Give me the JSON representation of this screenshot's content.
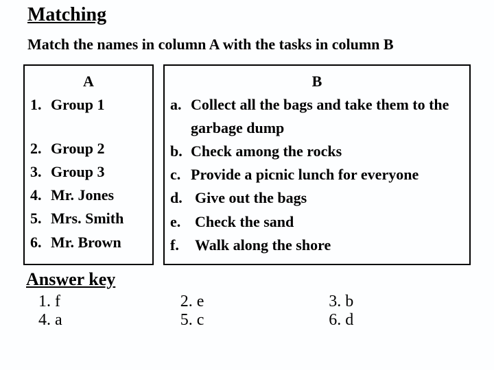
{
  "heading": "Matching",
  "instruction": "Match the names in column A with the tasks in column B",
  "colA": {
    "header": "A",
    "items": [
      {
        "num": "1.",
        "text": "Group 1"
      },
      {
        "num": "2.",
        "text": "Group 2"
      },
      {
        "num": "3.",
        "text": "Group 3"
      },
      {
        "num": "4.",
        "text": "Mr. Jones"
      },
      {
        "num": "5.",
        "text": "Mrs. Smith"
      },
      {
        "num": "6.",
        "text": "Mr. Brown"
      }
    ]
  },
  "colB": {
    "header": "B",
    "items": [
      {
        "num": "a.",
        "text": "Collect all the bags and take them to the garbage dump"
      },
      {
        "num": "b.",
        "text": "Check among the rocks"
      },
      {
        "num": "c.",
        "text": "Provide a picnic lunch for everyone"
      },
      {
        "num": "d.",
        "text": "Give out the bags"
      },
      {
        "num": "e.",
        "text": "Check the sand"
      },
      {
        "num": "f.",
        "text": "Walk along the shore"
      }
    ]
  },
  "answer_key_title": "Answer key",
  "answers": {
    "c1": [
      "1. f",
      "4. a"
    ],
    "c2": [
      "2. e",
      "5. c"
    ],
    "c3": [
      "3. b",
      "6. d"
    ]
  }
}
